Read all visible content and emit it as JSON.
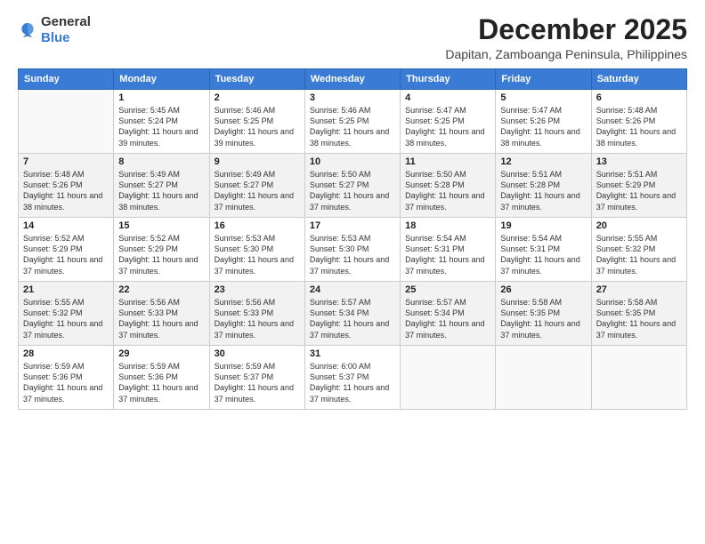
{
  "header": {
    "logo": {
      "general": "General",
      "blue": "Blue"
    },
    "month": "December 2025",
    "location": "Dapitan, Zamboanga Peninsula, Philippines"
  },
  "days_of_week": [
    "Sunday",
    "Monday",
    "Tuesday",
    "Wednesday",
    "Thursday",
    "Friday",
    "Saturday"
  ],
  "weeks": [
    [
      {
        "num": "",
        "empty": true
      },
      {
        "num": "1",
        "sunrise": "5:45 AM",
        "sunset": "5:24 PM",
        "daylight": "11 hours and 39 minutes."
      },
      {
        "num": "2",
        "sunrise": "5:46 AM",
        "sunset": "5:25 PM",
        "daylight": "11 hours and 39 minutes."
      },
      {
        "num": "3",
        "sunrise": "5:46 AM",
        "sunset": "5:25 PM",
        "daylight": "11 hours and 38 minutes."
      },
      {
        "num": "4",
        "sunrise": "5:47 AM",
        "sunset": "5:25 PM",
        "daylight": "11 hours and 38 minutes."
      },
      {
        "num": "5",
        "sunrise": "5:47 AM",
        "sunset": "5:26 PM",
        "daylight": "11 hours and 38 minutes."
      },
      {
        "num": "6",
        "sunrise": "5:48 AM",
        "sunset": "5:26 PM",
        "daylight": "11 hours and 38 minutes."
      }
    ],
    [
      {
        "num": "7",
        "sunrise": "5:48 AM",
        "sunset": "5:26 PM",
        "daylight": "11 hours and 38 minutes."
      },
      {
        "num": "8",
        "sunrise": "5:49 AM",
        "sunset": "5:27 PM",
        "daylight": "11 hours and 38 minutes."
      },
      {
        "num": "9",
        "sunrise": "5:49 AM",
        "sunset": "5:27 PM",
        "daylight": "11 hours and 37 minutes."
      },
      {
        "num": "10",
        "sunrise": "5:50 AM",
        "sunset": "5:27 PM",
        "daylight": "11 hours and 37 minutes."
      },
      {
        "num": "11",
        "sunrise": "5:50 AM",
        "sunset": "5:28 PM",
        "daylight": "11 hours and 37 minutes."
      },
      {
        "num": "12",
        "sunrise": "5:51 AM",
        "sunset": "5:28 PM",
        "daylight": "11 hours and 37 minutes."
      },
      {
        "num": "13",
        "sunrise": "5:51 AM",
        "sunset": "5:29 PM",
        "daylight": "11 hours and 37 minutes."
      }
    ],
    [
      {
        "num": "14",
        "sunrise": "5:52 AM",
        "sunset": "5:29 PM",
        "daylight": "11 hours and 37 minutes."
      },
      {
        "num": "15",
        "sunrise": "5:52 AM",
        "sunset": "5:29 PM",
        "daylight": "11 hours and 37 minutes."
      },
      {
        "num": "16",
        "sunrise": "5:53 AM",
        "sunset": "5:30 PM",
        "daylight": "11 hours and 37 minutes."
      },
      {
        "num": "17",
        "sunrise": "5:53 AM",
        "sunset": "5:30 PM",
        "daylight": "11 hours and 37 minutes."
      },
      {
        "num": "18",
        "sunrise": "5:54 AM",
        "sunset": "5:31 PM",
        "daylight": "11 hours and 37 minutes."
      },
      {
        "num": "19",
        "sunrise": "5:54 AM",
        "sunset": "5:31 PM",
        "daylight": "11 hours and 37 minutes."
      },
      {
        "num": "20",
        "sunrise": "5:55 AM",
        "sunset": "5:32 PM",
        "daylight": "11 hours and 37 minutes."
      }
    ],
    [
      {
        "num": "21",
        "sunrise": "5:55 AM",
        "sunset": "5:32 PM",
        "daylight": "11 hours and 37 minutes."
      },
      {
        "num": "22",
        "sunrise": "5:56 AM",
        "sunset": "5:33 PM",
        "daylight": "11 hours and 37 minutes."
      },
      {
        "num": "23",
        "sunrise": "5:56 AM",
        "sunset": "5:33 PM",
        "daylight": "11 hours and 37 minutes."
      },
      {
        "num": "24",
        "sunrise": "5:57 AM",
        "sunset": "5:34 PM",
        "daylight": "11 hours and 37 minutes."
      },
      {
        "num": "25",
        "sunrise": "5:57 AM",
        "sunset": "5:34 PM",
        "daylight": "11 hours and 37 minutes."
      },
      {
        "num": "26",
        "sunrise": "5:58 AM",
        "sunset": "5:35 PM",
        "daylight": "11 hours and 37 minutes."
      },
      {
        "num": "27",
        "sunrise": "5:58 AM",
        "sunset": "5:35 PM",
        "daylight": "11 hours and 37 minutes."
      }
    ],
    [
      {
        "num": "28",
        "sunrise": "5:59 AM",
        "sunset": "5:36 PM",
        "daylight": "11 hours and 37 minutes."
      },
      {
        "num": "29",
        "sunrise": "5:59 AM",
        "sunset": "5:36 PM",
        "daylight": "11 hours and 37 minutes."
      },
      {
        "num": "30",
        "sunrise": "5:59 AM",
        "sunset": "5:37 PM",
        "daylight": "11 hours and 37 minutes."
      },
      {
        "num": "31",
        "sunrise": "6:00 AM",
        "sunset": "5:37 PM",
        "daylight": "11 hours and 37 minutes."
      },
      {
        "num": "",
        "empty": true
      },
      {
        "num": "",
        "empty": true
      },
      {
        "num": "",
        "empty": true
      }
    ]
  ],
  "labels": {
    "sunrise_prefix": "Sunrise: ",
    "sunset_prefix": "Sunset: ",
    "daylight_prefix": "Daylight: "
  }
}
